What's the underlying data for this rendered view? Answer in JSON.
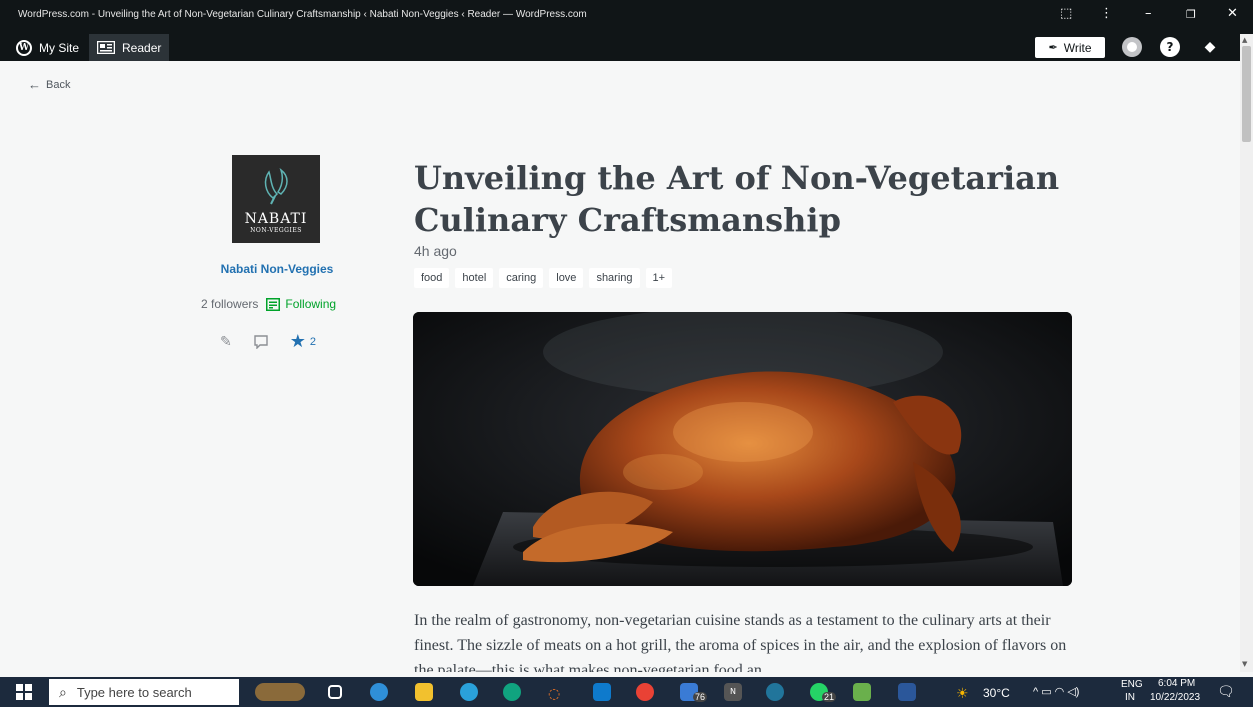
{
  "window": {
    "title": "WordPress.com - Unveiling the Art of Non-Vegetarian Culinary Craftsmanship ‹ Nabati Non-Veggies ‹ Reader — WordPress.com",
    "minimize": "–",
    "restore": "❐",
    "close": "✕"
  },
  "masterbar": {
    "my_site": "My Site",
    "reader": "Reader",
    "write": "Write"
  },
  "back_label": "Back",
  "site": {
    "logo_line1": "NABATI",
    "logo_line2": "NON-VEGGIES",
    "name": "Nabati Non-Veggies",
    "followers": "2 followers",
    "following": "Following",
    "like_count": "2"
  },
  "post": {
    "title": "Unveiling the Art of Non-Vegetarian Culinary Craftsmanship",
    "time": "4h ago",
    "tags": [
      "food",
      "hotel",
      "caring",
      "love",
      "sharing",
      "1+"
    ],
    "body": "In the realm of gastronomy, non-vegetarian cuisine stands as a testament to the culinary arts at their finest. The sizzle of meats on a hot grill, the aroma of spices in the air, and the explosion of flavors on the palate—this is what makes non-vegetarian food an"
  },
  "taskbar": {
    "search_placeholder": "Type here to search",
    "telegram_badge": "76",
    "whatsapp_badge": "21",
    "weather": "30°C",
    "lang1": "ENG",
    "lang2": "IN",
    "time": "6:04 PM",
    "date": "10/22/2023"
  },
  "colors": {
    "masterbar": "#101517",
    "link": "#2271b1",
    "following": "#00a32a",
    "taskbar": "#1c2a3d"
  }
}
